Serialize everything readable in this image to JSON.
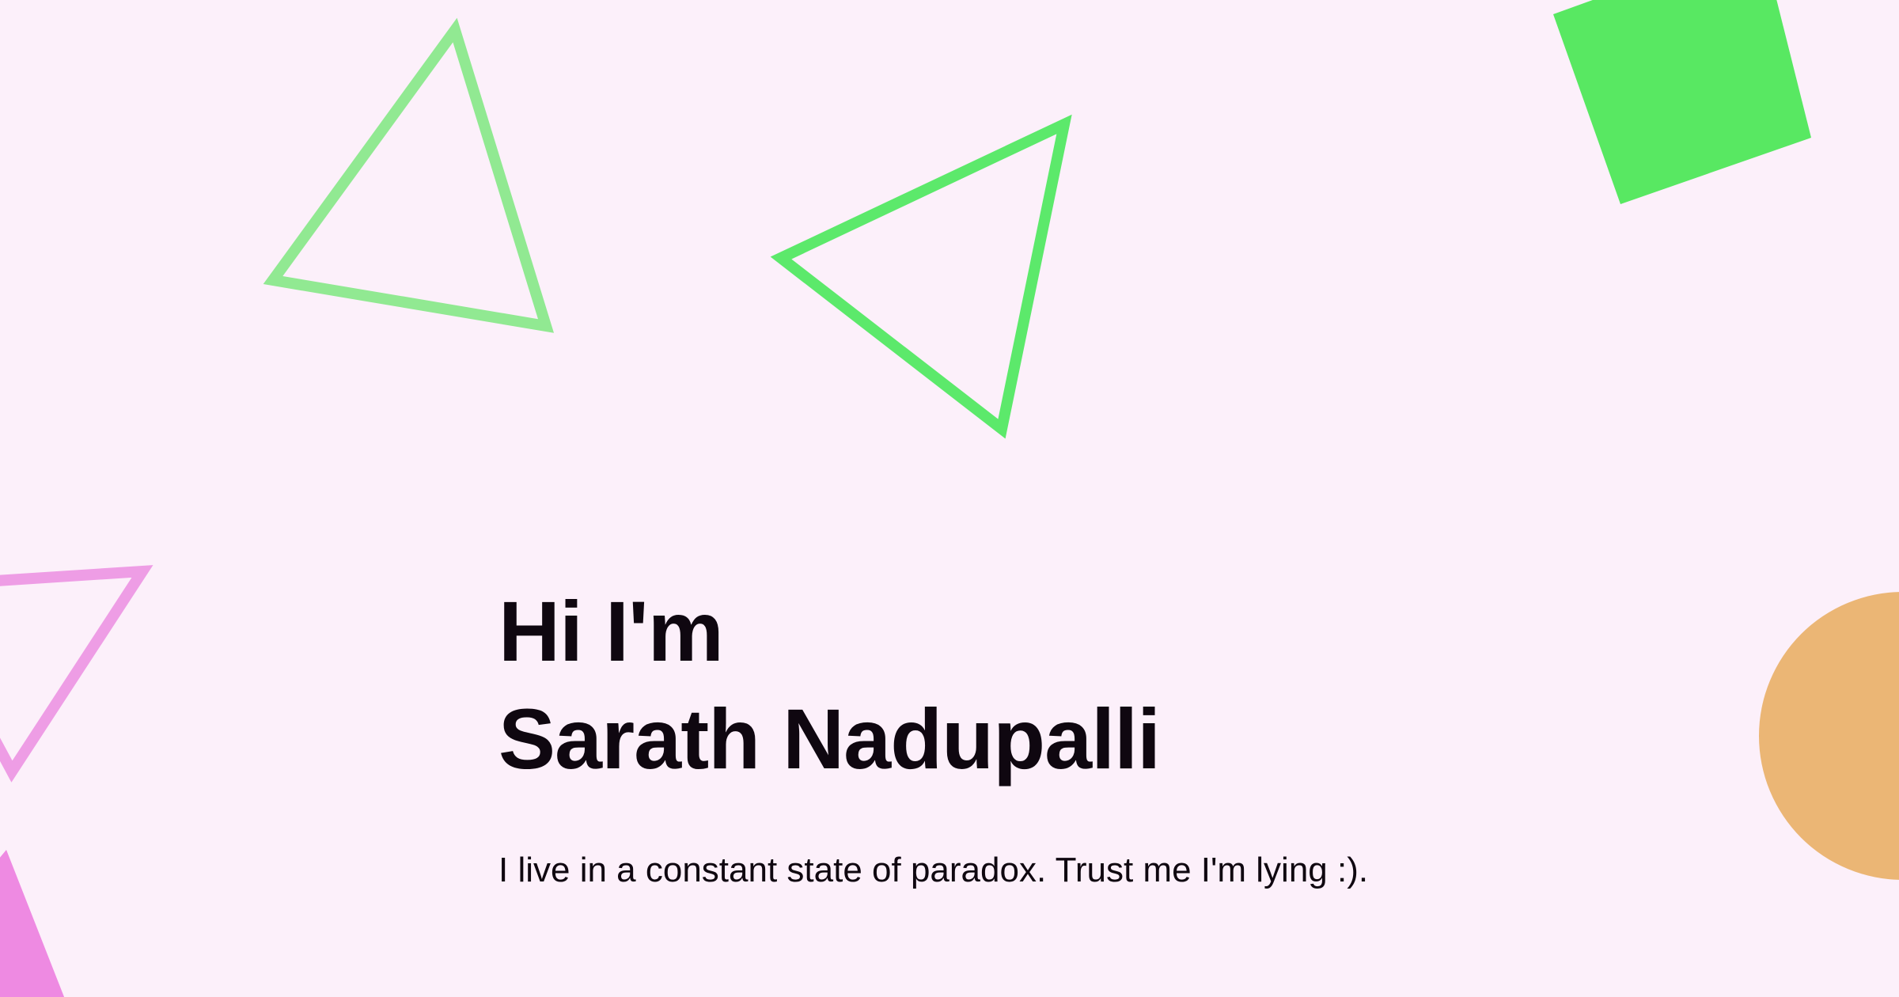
{
  "hero": {
    "greeting_line1": "Hi I'm",
    "greeting_line2": "Sarath Nadupalli",
    "tagline": "I live in a constant state of paradox. Trust me I'm lying :)."
  },
  "colors": {
    "background": "#fcf0fa",
    "text": "#0f0710",
    "green_light": "#91e992",
    "green": "#5ce96b",
    "green_solid": "#58e862",
    "pink_light": "#ee9de5",
    "pink": "#ee8ae2",
    "orange": "#ebb675"
  },
  "decorations": [
    "outlined-triangle",
    "outlined-triangle",
    "filled-square",
    "outlined-triangle",
    "filled-triangle",
    "filled-circle"
  ]
}
